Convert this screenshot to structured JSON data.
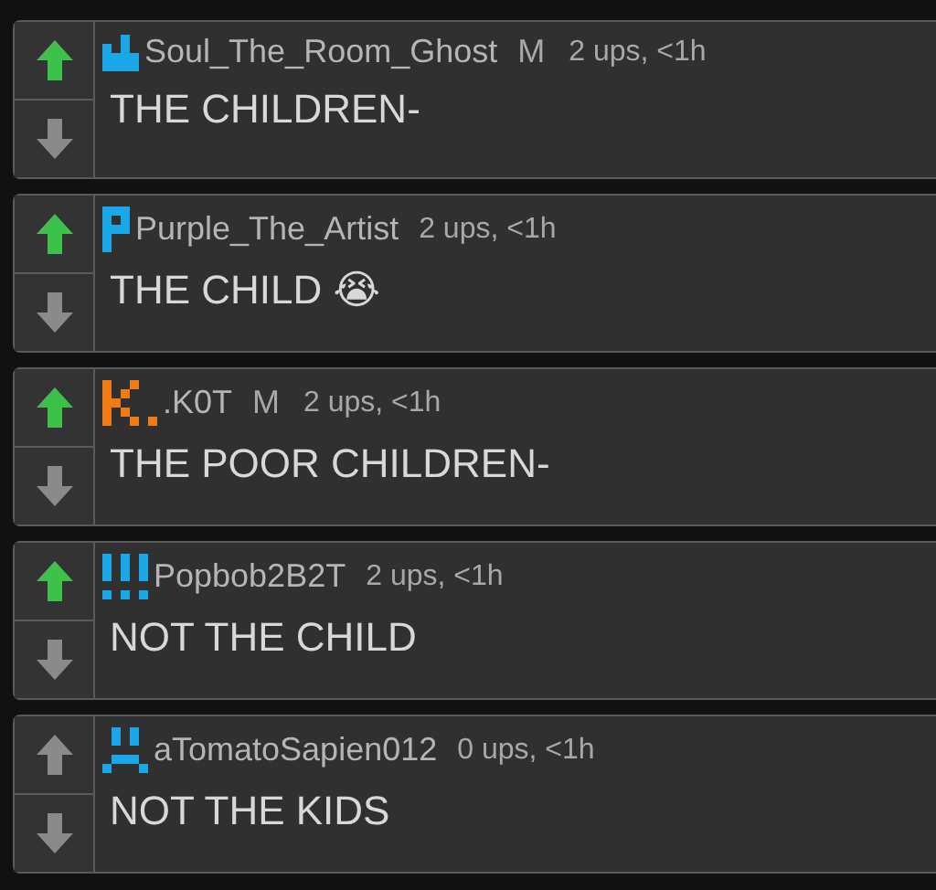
{
  "comments": [
    {
      "username": "Soul_The_Room_Ghost",
      "color": "#1aa7e8",
      "badge": "M",
      "meta": "2 ups, <1h",
      "text": "THE CHILDREN-",
      "upvoted": true
    },
    {
      "username": "Purple_The_Artist",
      "color": "#1aa7e8",
      "meta": "2 ups, <1h",
      "text": "THE CHILD 😭",
      "upvoted": true
    },
    {
      "username": ".K0T",
      "color": "#f07a14",
      "badge": "M",
      "meta": "2 ups, <1h",
      "text": "THE POOR CHILDREN-",
      "upvoted": true
    },
    {
      "username": "Popbob2B2T",
      "color": "#1aa7e8",
      "meta": "2 ups, <1h",
      "text": "NOT THE CHILD",
      "upvoted": true
    },
    {
      "username": "aTomatoSapien012",
      "color": "#1aa7e8",
      "meta": "0 ups, <1h",
      "text": "NOT THE KIDS",
      "upvoted": false
    }
  ]
}
